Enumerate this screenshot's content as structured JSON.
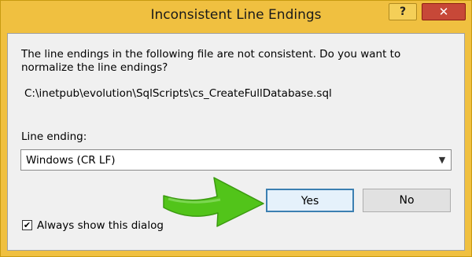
{
  "dialog": {
    "title": "Inconsistent Line Endings",
    "help_label": "?",
    "close_label": "✕",
    "message": "The line endings in the following file are not consistent. Do you want to normalize the line endings?",
    "file_path": "C:\\inetpub\\evolution\\SqlScripts\\cs_CreateFullDatabase.sql",
    "line_ending_label": "Line ending:",
    "line_ending_value": "Windows (CR LF)",
    "yes_label": "Yes",
    "no_label": "No",
    "checkbox_label": "Always show this dialog",
    "checkbox_checked": true,
    "checkmark": "✔"
  },
  "colors": {
    "title_bar": "#f0c040",
    "close_button": "#c74838",
    "default_button_border": "#3c7fb1",
    "annotation_arrow": "#52c41a"
  }
}
